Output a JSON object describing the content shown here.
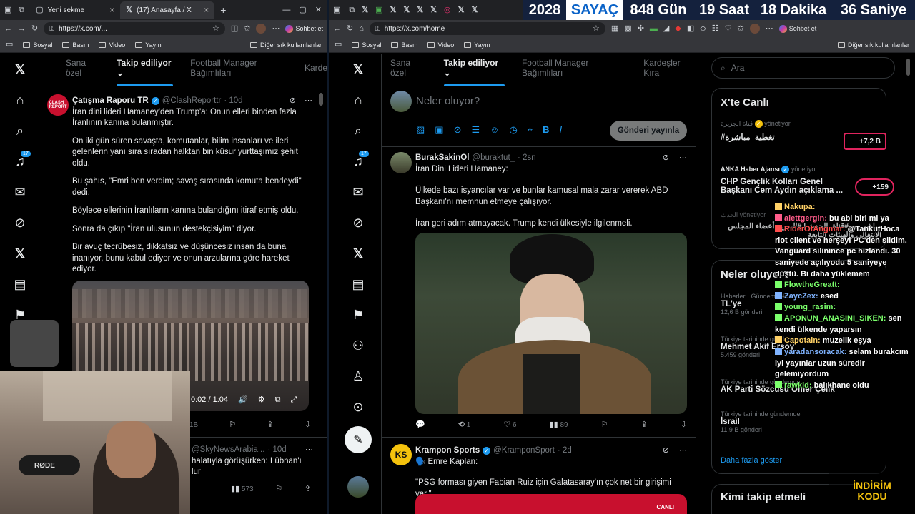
{
  "left_browser": {
    "tabs": [
      {
        "label": "Yeni sekme"
      },
      {
        "label": "(17) Anasayfa / X"
      }
    ],
    "url": "https://x.com/...",
    "chat_button": "Sohbet et",
    "bookmarks": [
      "Sosyal",
      "Basın",
      "Video",
      "Yayın"
    ],
    "other_bookmarks": "Diğer sık kullanılanlar",
    "notif_count": "17",
    "feed_tabs": [
      "Sana özel",
      "Takip ediliyor",
      "Football Manager Bağımlıları",
      "Karde"
    ],
    "post": {
      "name": "Çatışma Raporu TR",
      "handle": "@ClashReporttr",
      "time": "· 10d",
      "paragraphs": [
        "İran dini lideri Hamaney'den Trump'a: Onun elleri binden fazla İranlının kanına bulanmıştır.",
        "On iki gün süren savaşta, komutanlar, bilim insanları ve ileri gelenlerin yanı sıra sıradan halktan bin küsur yurttaşımız şehit oldu.",
        "Bu şahıs, \"Emri ben verdim; savaş sırasında komuta bendeydi\" dedi.",
        "Böylece ellerinin İranlıların kanına bulandığını itiraf etmiş oldu.",
        "Sonra da çıkıp \"İran ulusunun destekçisiyim\" diyor.",
        "Bir avuç tecrübesiz, dikkatsiz ve düşüncesiz insan da buna inanıyor, bunu kabul ediyor ve onun arzularına göre hareket ediyor."
      ],
      "video_time": "0:02 / 1:04",
      "bookmark_count": "1B"
    },
    "post2": {
      "handle": "@SkyNewsArabia...",
      "time": "· 10d",
      "text": "halatıyla görüşürken: Lübnan'ı",
      "text2": "lur",
      "views": "573"
    }
  },
  "right_browser": {
    "url": "https://x.com/home",
    "chat_button": "Sohbet et",
    "bookmarks": [
      "Sosyal",
      "Basın",
      "Video",
      "Yayın"
    ],
    "other_bookmarks": "Diğer sık kullanılanlar",
    "notif_count": "17",
    "feed_tabs": [
      "Sana özel",
      "Takip ediliyor",
      "Football Manager Bağımlıları",
      "Kardeşler Kıra"
    ],
    "composer_placeholder": "Neler oluyor?",
    "post_button": "Gönderi yayınla",
    "post1": {
      "name": "BurakSakinOl",
      "handle": "@buraktut_",
      "time": "· 2sn",
      "lines": [
        "İran Dini Lideri Hamaney:",
        "Ülkede bazı isyancılar var ve bunlar kamusal mala zarar vererek ABD Başkanı'nı memnun etmeye çalışıyor.",
        "İran geri adım atmayacak. Trump kendi ülkesiyle ilgilenmeli."
      ],
      "retweets": "1",
      "likes": "6",
      "views": "89"
    },
    "post2": {
      "name": "Krampon Sports",
      "handle": "@KramponSport",
      "time": "· 2d",
      "line1": "🗣️ Emre Kaplan:",
      "line2": "\"PSG forması giyen Fabian Ruiz için Galatasaray'ın çok net bir girişimi var.\"",
      "image_label": "CANLI"
    },
    "search_placeholder": "Ara",
    "live": {
      "title": "X'te Canlı",
      "items": [
        {
          "host": "قناة الجزيرة",
          "role": "yönetiyor",
          "title": "#تغطية_مباشرة",
          "count": "+7,2 B"
        },
        {
          "host": "ANKA Haber Ajansı",
          "role": "yönetiyor",
          "title": "CHP Gençlik Kolları Genel Başkanı Cem Aydın açıklama ...",
          "count": "+159"
        },
        {
          "host": "الحدث",
          "role": "yönetiyor",
          "title": "مباشر من #قناة_الحدث | #اليمن.. أعضاء المجلس الانتقالي والهيئات التابعة"
        }
      ]
    },
    "trends": {
      "title": "Neler oluyor?",
      "items": [
        {
          "meta": "Haberler · Gündemdekiler",
          "title": "TL'ye",
          "count": "12,6 B gönderi"
        },
        {
          "meta": "Türkiye tarihinde gündemde",
          "title": "Mehmet Akif Ersoy",
          "count": "5.459 gönderi"
        },
        {
          "meta": "Türkiye tarihinde gündemde",
          "title": "AK Parti Sözcüsü Ömer Çelik",
          "count": ""
        },
        {
          "meta": "Türkiye tarihinde gündemde",
          "title": "İsrail",
          "count": "11,9 B gönderi"
        }
      ],
      "show_more": "Daha fazla göster"
    },
    "who_to_follow": "Kimi takip etmeli"
  },
  "overlay": {
    "counter": [
      {
        "value": "2028"
      },
      {
        "value": "SAYAÇ"
      },
      {
        "value": "848 Gün"
      },
      {
        "value": "19 Saat"
      },
      {
        "value": "18 Dakika"
      },
      {
        "value": "36 Saniye"
      }
    ],
    "discount_line1": "İNDİRİM",
    "discount_line2": "KODU",
    "mic_brand": "RØDE"
  },
  "chat": [
    {
      "user": "Nakupa:",
      "text": "",
      "color": "#ffd166"
    },
    {
      "user": "alettgergin:",
      "text": "bu abi biri mi ya",
      "color": "#ff5c8a"
    },
    {
      "user": "RiderOfAngmar:",
      "text": "@TankutHoca riot client ve herşeyi PC'den sildim. Vanguard silinince pc hızlandı. 30 saniyede açılıyodu 5 saniyeye düştü. Bi daha yüklemem",
      "color": "#ff4d4d"
    },
    {
      "user": "FlowtheGreatt:",
      "text": "",
      "color": "#7bff6b"
    },
    {
      "user": "ZaycZex:",
      "text": "esed",
      "color": "#7fb3ff"
    },
    {
      "user": "young_rasim:",
      "text": "",
      "color": "#7bff6b"
    },
    {
      "user": "APONUN_ANASINI_SIKEN:",
      "text": "sen kendi ülkende yaparsın",
      "color": "#7bff6b"
    },
    {
      "user": "Capotain:",
      "text": "muzelik eşya",
      "color": "#ffd166"
    },
    {
      "user": "yaradansoracak:",
      "text": "selam burakcım iyi yayınlar uzun süredir gelemiyordum",
      "color": "#7fb3ff"
    },
    {
      "user": "rawkid:",
      "text": "balıkhane oldu",
      "color": "#7bff6b"
    }
  ],
  "colors": {
    "accent": "#1d9bf0",
    "bg": "#000000",
    "border": "#2f3336",
    "muted": "#71767b"
  }
}
